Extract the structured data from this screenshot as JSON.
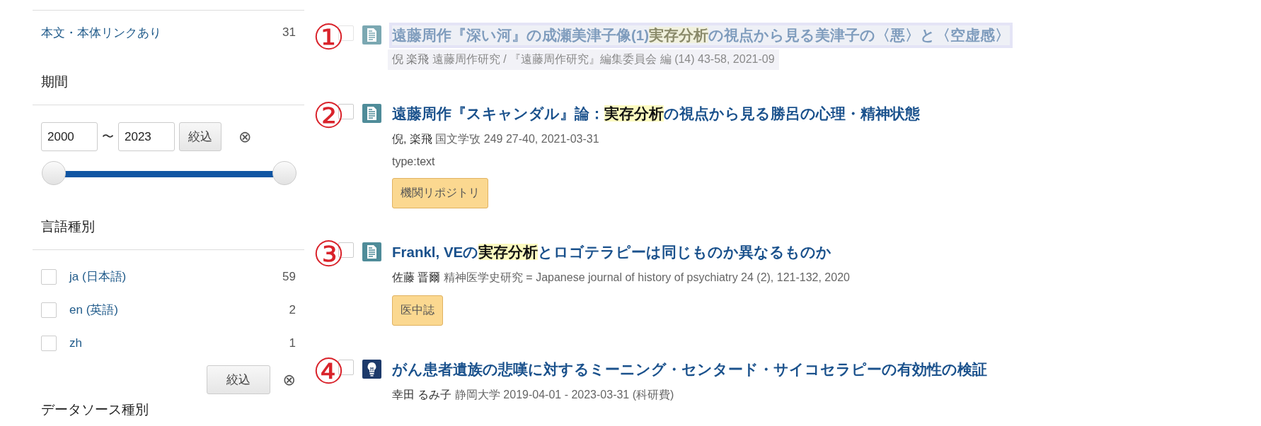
{
  "sidebar": {
    "fulltext_filter": {
      "label": "本文・本体リンクあり",
      "count": "31"
    },
    "period": {
      "heading": "期間",
      "from": "2000",
      "separator": "〜",
      "to": "2023",
      "apply": "絞込",
      "clear": "⊗"
    },
    "language": {
      "heading": "言語種別",
      "options": [
        {
          "label": "ja (日本語)",
          "count": "59",
          "checked": false
        },
        {
          "label": "en (英語)",
          "count": "2",
          "checked": false
        },
        {
          "label": "zh",
          "count": "1",
          "checked": false
        }
      ],
      "apply": "絞込",
      "clear": "⊗"
    },
    "next_heading": "データソース種別"
  },
  "results": [
    {
      "marker": "①",
      "kind": "document",
      "faded": true,
      "checked": false,
      "title": [
        {
          "text": "遠藤周作『深い河』の成瀬美津子像(1)",
          "highlighted": false
        },
        {
          "text": "実存分析",
          "highlighted": true
        },
        {
          "text": "の視点から見る美津子の〈悪〉と〈空虚感〉",
          "highlighted": false
        }
      ],
      "author": "倪 楽飛",
      "source": "遠藤周作研究 / 『遠藤周作研究』編集委員会 編 (14) 43-58, 2021-09"
    },
    {
      "marker": "②",
      "kind": "document",
      "faded": false,
      "checked": false,
      "title": [
        {
          "text": "遠藤周作『スキャンダル』論：",
          "highlighted": false
        },
        {
          "text": "実存分析",
          "highlighted": true
        },
        {
          "text": "の視点から見る勝呂の心理・精神状態",
          "highlighted": false
        }
      ],
      "author": "倪, 楽飛",
      "source": "国文学攷 249 27-40, 2021-03-31",
      "type_line": "type:text",
      "tag": "機関リポジトリ"
    },
    {
      "marker": "③",
      "kind": "document",
      "faded": false,
      "checked": false,
      "title": [
        {
          "text": "Frankl, VEの",
          "highlighted": false
        },
        {
          "text": "実存分析",
          "highlighted": true
        },
        {
          "text": "とロゴテラピーは同じものか異なるものか",
          "highlighted": false
        }
      ],
      "author": "佐藤 晋爾",
      "source": "精神医学史研究 = Japanese journal of history of psychiatry 24 (2), 121-132, 2020",
      "tag": "医中誌"
    },
    {
      "marker": "④",
      "kind": "project",
      "faded": false,
      "checked": false,
      "title": [
        {
          "text": "がん患者遺族の悲嘆に対するミーニング・センタード・サイコセラピーの有効性の検証",
          "highlighted": false
        }
      ],
      "author": "幸田 るみ子",
      "source": "静岡大学 2019-04-01 - 2023-03-31 (科研費)"
    }
  ]
}
